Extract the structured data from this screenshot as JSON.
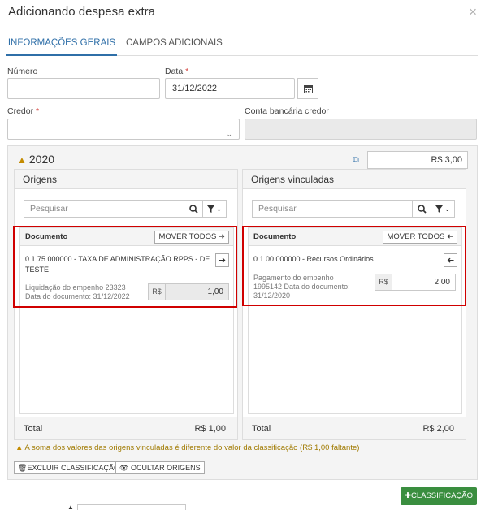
{
  "modal": {
    "title": "Adicionando despesa extra",
    "close": "×"
  },
  "tabs": [
    {
      "label": "INFORMAÇÕES GERAIS"
    },
    {
      "label": "CAMPOS ADICIONAIS"
    }
  ],
  "form": {
    "numero": {
      "label": "Número",
      "value": ""
    },
    "data": {
      "label": "Data",
      "required": "*",
      "value": "31/12/2022"
    },
    "credor": {
      "label": "Credor",
      "required": "*",
      "value": ""
    },
    "conta": {
      "label": "Conta bancária credor",
      "value": ""
    }
  },
  "panel": {
    "year": "2020",
    "total": "R$ 3,00",
    "origens": {
      "title": "Origens",
      "search_placeholder": "Pesquisar",
      "doc_header": "Documento",
      "move_all": "MOVER TODOS",
      "item": {
        "title": "0.1.75.000000 - TAXA DE ADMINISTRAÇÃO RPPS - DE TESTE",
        "meta_line1": "Liquidação do empenho 23323",
        "meta_line2": "Data do documento: 31/12/2022",
        "currency": "R$",
        "amount": "1,00"
      },
      "total_label": "Total",
      "total_value": "R$ 1,00"
    },
    "vinculadas": {
      "title": "Origens vinculadas",
      "search_placeholder": "Pesquisar",
      "doc_header": "Documento",
      "move_all": "MOVER TODOS",
      "item": {
        "title": "0.1.00.000000 - Recursos Ordinários",
        "meta_line1": "Pagamento do empenho",
        "meta_line2": "1995142 Data do documento:",
        "meta_line3": "31/12/2020",
        "currency": "R$",
        "amount": "2,00"
      },
      "total_label": "Total",
      "total_value": "R$ 2,00"
    },
    "warning": "A soma dos valores das origens vinculadas é diferente do valor da classificação (R$ 1,00 faltante)",
    "delete_btn": "EXCLUIR CLASSIFICAÇÃO",
    "hide_btn": "OCULTAR ORIGENS"
  },
  "add_classification": "CLASSIFICAÇÃO",
  "colors": {
    "accent": "#2f6fa8",
    "success": "#3a8e3f",
    "highlight": "#d00000",
    "warning": "#c48b00"
  }
}
